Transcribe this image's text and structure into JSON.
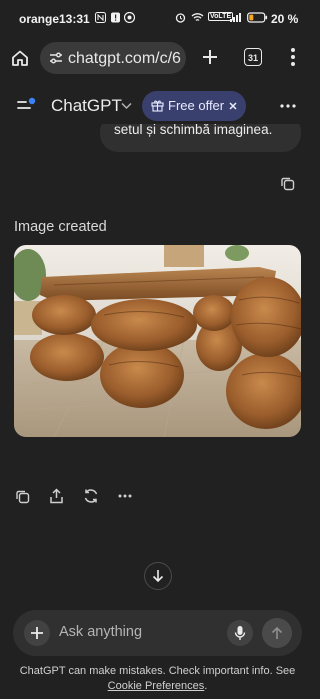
{
  "status_bar": {
    "carrier": "orange",
    "time": "13:31",
    "battery_percent": "20 %",
    "network_badge": "VoLTE"
  },
  "browser": {
    "url": "chatgpt.com/c/6",
    "tab_count": "31"
  },
  "app": {
    "title": "ChatGPT",
    "offer_label": "Free offer"
  },
  "conversation": {
    "user_message_fragment": "setul și schimbă imaginea.",
    "image_created_label": "Image created"
  },
  "composer": {
    "placeholder": "Ask anything"
  },
  "footer": {
    "disclaimer": "ChatGPT can make mistakes. Check important info. See",
    "cookie_link": "Cookie Preferences",
    "cookie_suffix": "."
  },
  "icons": {
    "home": "home-icon",
    "site_settings": "tune-icon",
    "new_tab": "plus-icon",
    "menu": "kebab-icon",
    "sidebar": "sidebar-icon",
    "chevron": "chevron-down-icon",
    "gift": "gift-icon",
    "copy": "copy-icon",
    "share": "share-icon",
    "regenerate": "refresh-icon",
    "scroll_down": "arrow-down-icon",
    "mic": "mic-icon",
    "send": "arrow-up-icon"
  },
  "colors": {
    "background": "#212121",
    "accent_dot": "#3b82f6",
    "offer_bg": "#39406e"
  }
}
